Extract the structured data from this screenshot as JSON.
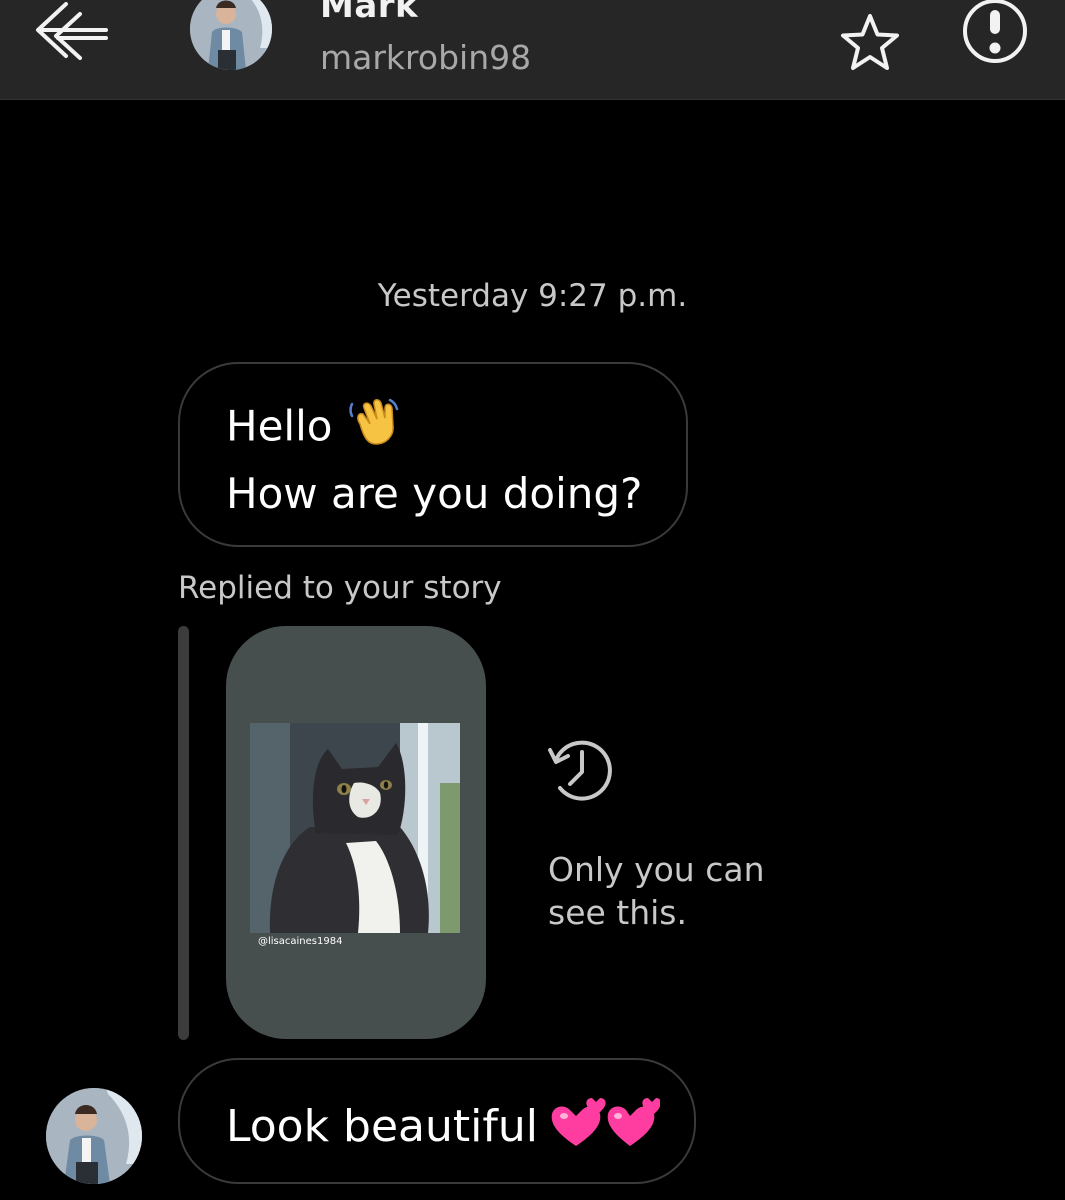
{
  "header": {
    "name": "Mark",
    "username": "markrobin98",
    "icons": [
      "back-arrow-icon",
      "star-icon",
      "info-icon"
    ]
  },
  "thread": {
    "timestamp": "Yesterday 9:27 p.m.",
    "message_1": {
      "line_1": "Hello",
      "line_2": "How are you doing?",
      "emoji": "waving-hand"
    },
    "story_reply": {
      "label": "Replied to your story",
      "story_handle": "@lisacaines1984",
      "notice": "Only you can see this.",
      "icon": "history-icon"
    },
    "message_2": {
      "text": "Look beautiful",
      "emoji": "two-hearts"
    }
  },
  "colors": {
    "background": "#000000",
    "header": "#262626",
    "bubble_border": "#3a3a3a",
    "story_card": "#474e4e",
    "secondary_text": "#c8c8c8",
    "heart_pink": "#ff3da1"
  }
}
